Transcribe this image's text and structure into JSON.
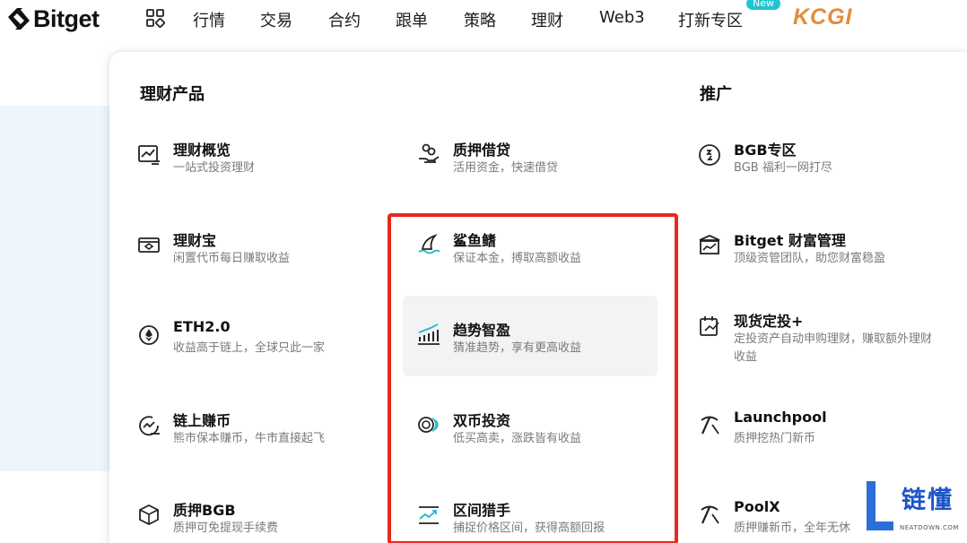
{
  "brand": {
    "logo_text": "Bitget"
  },
  "nav": {
    "items": [
      "行情",
      "交易",
      "合约",
      "跟单",
      "策略",
      "理财",
      "Web3",
      "打新专区"
    ],
    "new_badge": "New",
    "partner_logo": "KCGI"
  },
  "panel": {
    "col1_title": "理财产品",
    "col3_title": "推广",
    "col1": [
      {
        "title": "理财概览",
        "desc": "一站式投资理财",
        "icon": "chart-board-icon"
      },
      {
        "title": "理财宝",
        "desc": "闲置代币每日赚取收益",
        "icon": "wallet-icon"
      },
      {
        "title": "ETH2.0",
        "desc": "收益高于链上，全球只此一家",
        "icon": "ethereum-icon"
      },
      {
        "title": "链上赚币",
        "desc": "熊市保本赚币，牛市直接起飞",
        "icon": "onchain-earn-icon"
      },
      {
        "title": "质押BGB",
        "desc": "质押可免提现手续费",
        "icon": "stake-cube-icon"
      }
    ],
    "col2": [
      {
        "title": "质押借贷",
        "desc": "活用资金，快速借贷",
        "icon": "loan-hand-icon"
      },
      {
        "title": "鲨鱼鳍",
        "desc": "保证本金，搏取高额收益",
        "icon": "shark-fin-icon"
      },
      {
        "title": "趋势智盈",
        "desc": "猜准趋势，享有更高收益",
        "icon": "trend-bars-icon"
      },
      {
        "title": "双币投资",
        "desc": "低买高卖，涨跌皆有收益",
        "icon": "dual-coin-icon"
      },
      {
        "title": "区间猎手",
        "desc": "捕捉价格区间，获得高额回报",
        "icon": "range-chart-icon"
      }
    ],
    "col3": [
      {
        "title": "BGB专区",
        "desc": "BGB 福利一网打尽",
        "icon": "bgb-swap-icon"
      },
      {
        "title": "Bitget 财富管理",
        "desc": "顶级资管团队，助您财富稳盈",
        "icon": "bank-chart-icon"
      },
      {
        "title": "现货定投+",
        "desc": "定投资产自动申购理财，赚取额外理财收益",
        "icon": "calendar-invest-icon"
      },
      {
        "title": "Launchpool",
        "desc": "质押挖热门新币",
        "icon": "pickaxe-icon"
      },
      {
        "title": "PoolX",
        "desc": "质押赚新币，全年无休",
        "icon": "pickaxe-icon"
      }
    ]
  },
  "watermark": {
    "text": "链懂",
    "sub": "NEATDOWN.COM"
  },
  "colors": {
    "highlight_border": "#e8281f",
    "partner": "#e58b3a",
    "badge": "#20c4cf"
  }
}
